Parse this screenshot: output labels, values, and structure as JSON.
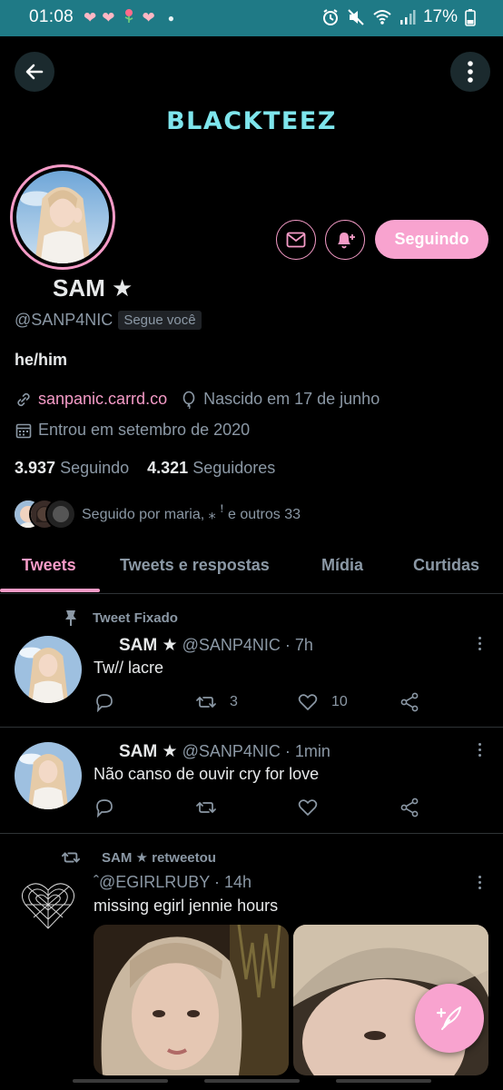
{
  "status_bar": {
    "time": "01:08",
    "battery": "17%",
    "notification_icons": [
      "heart-icon",
      "heart-icon",
      "rose-icon",
      "heart-icon",
      "dot"
    ]
  },
  "header": {
    "brand": "BLACKTEEZ",
    "back_icon": "arrow-left-icon",
    "more_icon": "more-vertical-icon"
  },
  "profile": {
    "name": "SAM ★",
    "handle": "@SANP4NIC",
    "follows_you": "Segue você",
    "bio": "he/him",
    "link": "sanpanic.carrd.co",
    "birthday": "Nascido em 17 de junho",
    "joined": "Entrou em setembro de 2020",
    "following_count": "3.937",
    "following_label": "Seguindo",
    "followers_count": "4.321",
    "followers_label": "Seguidores",
    "followed_by": "Seguido por maria, ⁎  ꜝ e outros 33",
    "follow_button": "Seguindo"
  },
  "tabs": [
    {
      "label": "Tweets",
      "active": true
    },
    {
      "label": "Tweets e respostas",
      "active": false
    },
    {
      "label": "Mídia",
      "active": false
    },
    {
      "label": "Curtidas",
      "active": false
    }
  ],
  "tweets": [
    {
      "context": "Tweet Fixado",
      "name": "SAM ★",
      "handle_time": "@SANP4NIC · 7h",
      "text": "Tw// lacre",
      "retweets": "3",
      "likes": "10"
    },
    {
      "context": "",
      "name": "SAM ★",
      "handle_time": "@SANP4NIC · 1min",
      "text": "Não canso de ouvir cry for love",
      "retweets": "",
      "likes": ""
    },
    {
      "context": "SAM ★ retweetou",
      "name": "",
      "handle_time": "ˆ@EGIRLRUBY · 14h",
      "text": "missing egirl jennie hours"
    }
  ],
  "colors": {
    "accent": "#f59bc7",
    "status_bar": "#1f7a86",
    "brand": "#7ee5ec",
    "background": "#000000"
  }
}
